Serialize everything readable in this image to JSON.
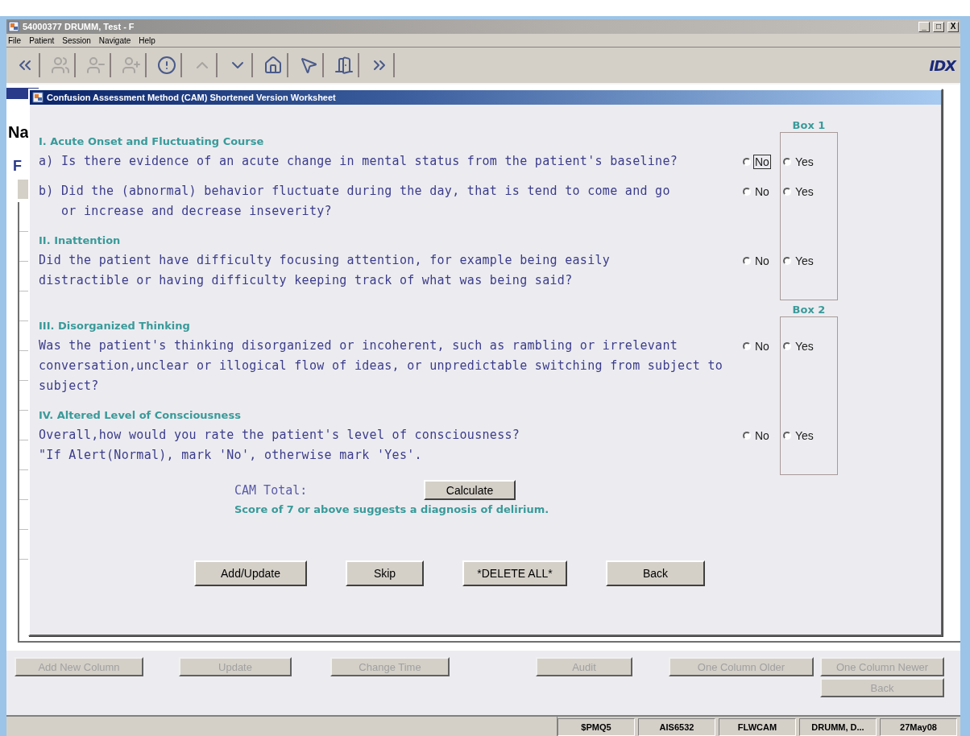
{
  "window": {
    "title": "54000377 DRUMM, Test - F",
    "controls": [
      "_",
      "□",
      "X"
    ],
    "logo": "IDX"
  },
  "menu": [
    "File",
    "Patient",
    "Session",
    "Navigate",
    "Help"
  ],
  "toolbar": [
    {
      "kind": "back",
      "disabled": false
    },
    {
      "kind": "patients",
      "disabled": true
    },
    {
      "kind": "previous",
      "disabled": true
    },
    {
      "kind": "next",
      "disabled": true
    },
    {
      "kind": "alert",
      "disabled": false
    },
    {
      "kind": "up",
      "disabled": true
    },
    {
      "kind": "down",
      "disabled": false
    },
    {
      "kind": "home",
      "disabled": false
    },
    {
      "kind": "help",
      "disabled": false
    },
    {
      "kind": "exit",
      "disabled": false
    },
    {
      "kind": "forward",
      "disabled": false
    }
  ],
  "background": {
    "heading": "Na",
    "tab_letter": "F"
  },
  "dialog": {
    "title": "Confusion Assessment Method (CAM) Shortened Version Worksheet",
    "groups": [
      {
        "box_label": "Box 1",
        "sections": [
          {
            "title": "I. Acute Onset and Fluctuating Course",
            "questions": [
              {
                "lines": [
                  "a) Is there evidence of an acute change in mental status from the patient's baseline?"
                ],
                "no": {
                  "label": "No",
                  "selected": false,
                  "focused": true
                },
                "yes": {
                  "label": "Yes",
                  "selected": false,
                  "focused": false
                }
              },
              {
                "lines": [
                  "b) Did the (abnormal) behavior fluctuate during the day, that is tend to come and go",
                  "   or increase and decrease inseverity?"
                ],
                "no": {
                  "label": "No",
                  "selected": false,
                  "focused": false
                },
                "yes": {
                  "label": "Yes",
                  "selected": false,
                  "focused": false
                }
              }
            ]
          },
          {
            "title": "II. Inattention",
            "questions": [
              {
                "lines": [
                  "Did the patient have difficulty focusing attention, for example being easily",
                  "distractible or having difficulty keeping track of what was being said?"
                ],
                "no": {
                  "label": "No",
                  "selected": false,
                  "focused": false
                },
                "yes": {
                  "label": "Yes",
                  "selected": false,
                  "focused": false
                }
              }
            ]
          }
        ]
      },
      {
        "box_label": "Box 2",
        "sections": [
          {
            "title": "III. Disorganized Thinking",
            "questions": [
              {
                "lines": [
                  "Was the patient's thinking disorganized or incoherent, such as rambling or irrelevant",
                  "conversation,unclear or illogical flow of ideas, or unpredictable switching from subject to",
                  "subject?"
                ],
                "no": {
                  "label": "No",
                  "selected": false,
                  "focused": false
                },
                "yes": {
                  "label": "Yes",
                  "selected": false,
                  "focused": false
                }
              }
            ]
          },
          {
            "title": "IV. Altered Level of Consciousness",
            "questions": [
              {
                "lines": [
                  "Overall,how would you rate the patient's level of consciousness?",
                  "\"If Alert(Normal), mark 'No', otherwise mark 'Yes'."
                ],
                "no": {
                  "label": "No",
                  "selected": false,
                  "focused": false
                },
                "yes": {
                  "label": "Yes",
                  "selected": false,
                  "focused": false
                }
              }
            ]
          }
        ]
      }
    ],
    "total_label": "CAM Total:",
    "calculate_button": "Calculate",
    "note": "Score of 7 or above suggests a diagnosis of delirium.",
    "actions": [
      "Add/Update",
      "Skip",
      "*DELETE ALL*",
      "Back"
    ]
  },
  "bottom_buttons": [
    {
      "label": "Add New Column",
      "disabled": true
    },
    {
      "label": "Update",
      "disabled": true
    },
    {
      "label": "Change Time",
      "disabled": true
    },
    {
      "label": "Audit",
      "disabled": true
    },
    {
      "label": "One Column Older",
      "disabled": true
    },
    {
      "label": "One Column Newer",
      "disabled": true
    }
  ],
  "back_button": {
    "label": "Back",
    "disabled": true
  },
  "status_bar": [
    "$PMQ5",
    "AIS6532",
    "FLWCAM",
    "DRUMM, D...",
    "27May08"
  ]
}
